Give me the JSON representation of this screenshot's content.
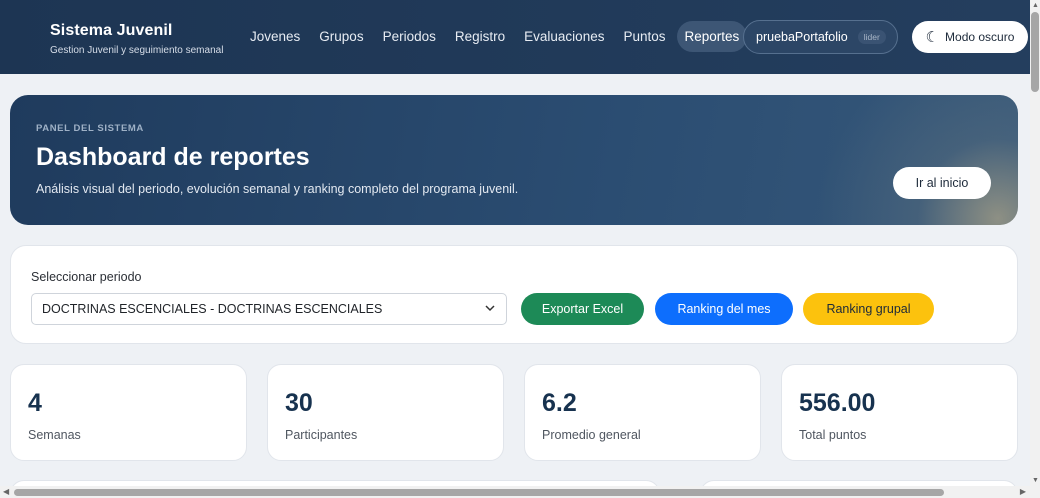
{
  "header": {
    "brand_title": "Sistema Juvenil",
    "brand_subtitle": "Gestion Juvenil y seguimiento semanal",
    "nav": [
      {
        "label": "Jovenes"
      },
      {
        "label": "Grupos"
      },
      {
        "label": "Periodos"
      },
      {
        "label": "Registro"
      },
      {
        "label": "Evaluaciones"
      },
      {
        "label": "Puntos"
      },
      {
        "label": "Reportes",
        "active": true
      }
    ],
    "user": {
      "name": "pruebaPortafolio",
      "role": "lider"
    },
    "dark_mode_label": "Modo oscuro",
    "dark_mode_icon": "moon-icon"
  },
  "hero": {
    "kicker": "PANEL DEL SISTEMA",
    "title": "Dashboard de reportes",
    "description": "Análisis visual del periodo, evolución semanal y ranking completo del programa juvenil.",
    "home_button": "Ir al inicio"
  },
  "period": {
    "label": "Seleccionar periodo",
    "selected": "DOCTRINAS ESCENCIALES - DOCTRINAS ESCENCIALES",
    "export_button": "Exportar Excel",
    "month_ranking_button": "Ranking del mes",
    "group_ranking_button": "Ranking grupal"
  },
  "stats": [
    {
      "value": "4",
      "label": "Semanas"
    },
    {
      "value": "30",
      "label": "Participantes"
    },
    {
      "value": "6.2",
      "label": "Promedio general"
    },
    {
      "value": "556.00",
      "label": "Total puntos"
    }
  ],
  "colors": {
    "header_bg": "#1d3553",
    "excel": "#1d8a57",
    "month": "#0d6efd",
    "group": "#fcc20d",
    "stat_value": "#17324f"
  }
}
